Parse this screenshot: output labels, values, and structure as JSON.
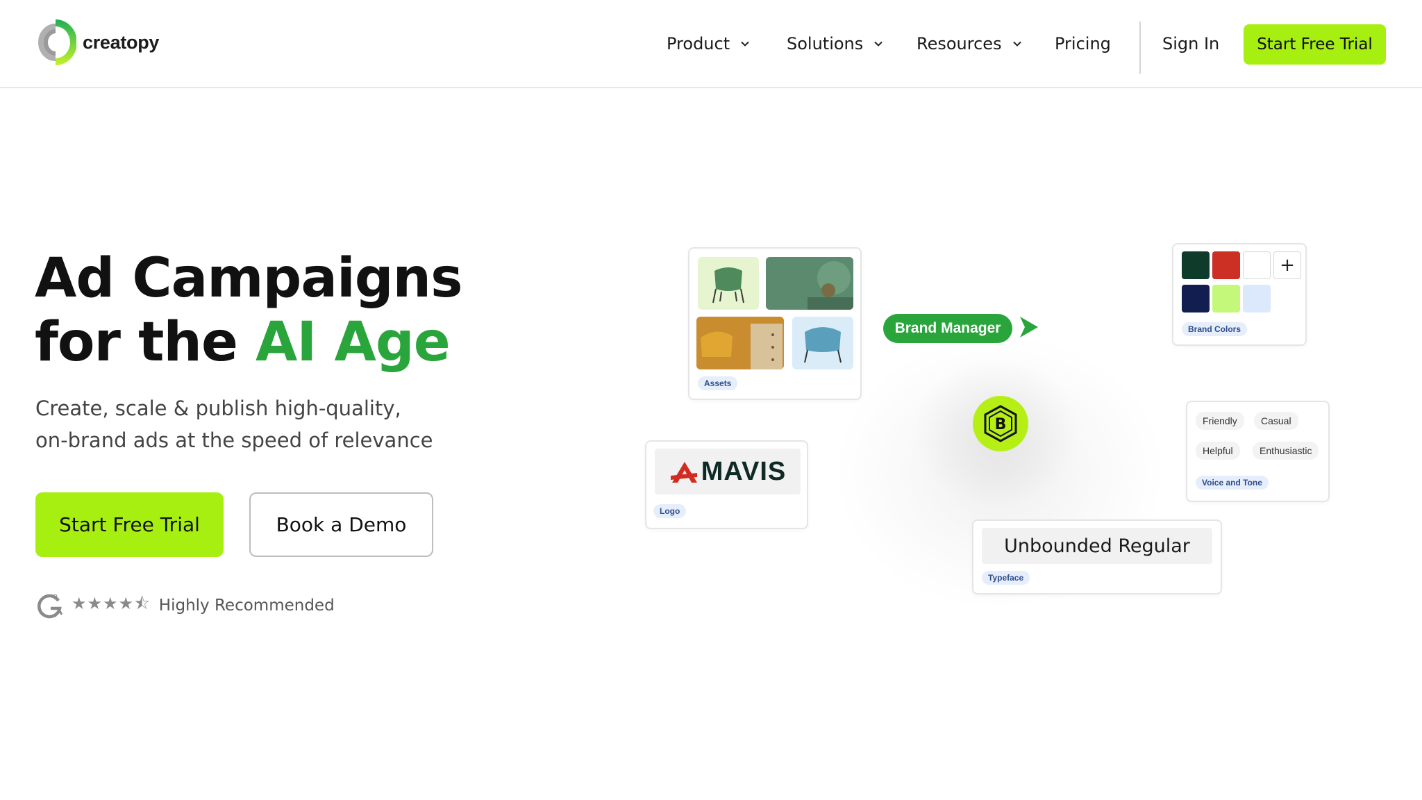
{
  "header": {
    "logo_text": "creatopy",
    "nav": [
      {
        "label": "Product",
        "has_dropdown": true
      },
      {
        "label": "Solutions",
        "has_dropdown": true
      },
      {
        "label": "Resources",
        "has_dropdown": true
      },
      {
        "label": "Pricing",
        "has_dropdown": false
      }
    ],
    "sign_in": "Sign In",
    "cta": "Start Free Trial"
  },
  "hero": {
    "title_line1": "Ad Campaigns",
    "title_line2_prefix": "for the ",
    "title_line2_accent": "AI Age",
    "subtitle_line1": "Create, scale & publish high-quality,",
    "subtitle_line2": "on-brand ads at the speed of relevance",
    "primary_cta": "Start Free Trial",
    "secondary_cta": "Book a Demo",
    "rating": {
      "stars": "★★★★⯪",
      "star_count": 4.5,
      "label": "Highly Recommended"
    }
  },
  "illustration": {
    "assets_tag": "Assets",
    "brand_manager": "Brand Manager",
    "brand_colors_tag": "Brand Colors",
    "brand_colors": [
      "#0f3b2a",
      "#cc2f23",
      "#ffffff",
      "#111e4f",
      "#c3f87a",
      "#dce8fb"
    ],
    "add_symbol": "+",
    "badge_letter": "B",
    "logo_brand": "MAVIS",
    "logo_tag": "Logo",
    "voice_chips": [
      "Friendly",
      "Casual",
      "Helpful",
      "Enthusiastic"
    ],
    "voice_tag": "Voice and Tone",
    "typeface_name": "Unbounded Regular",
    "typeface_tag": "Typeface"
  },
  "colors": {
    "accent_lime": "#a6ef11",
    "accent_green": "#2aa53c",
    "text_dark": "#111111"
  }
}
